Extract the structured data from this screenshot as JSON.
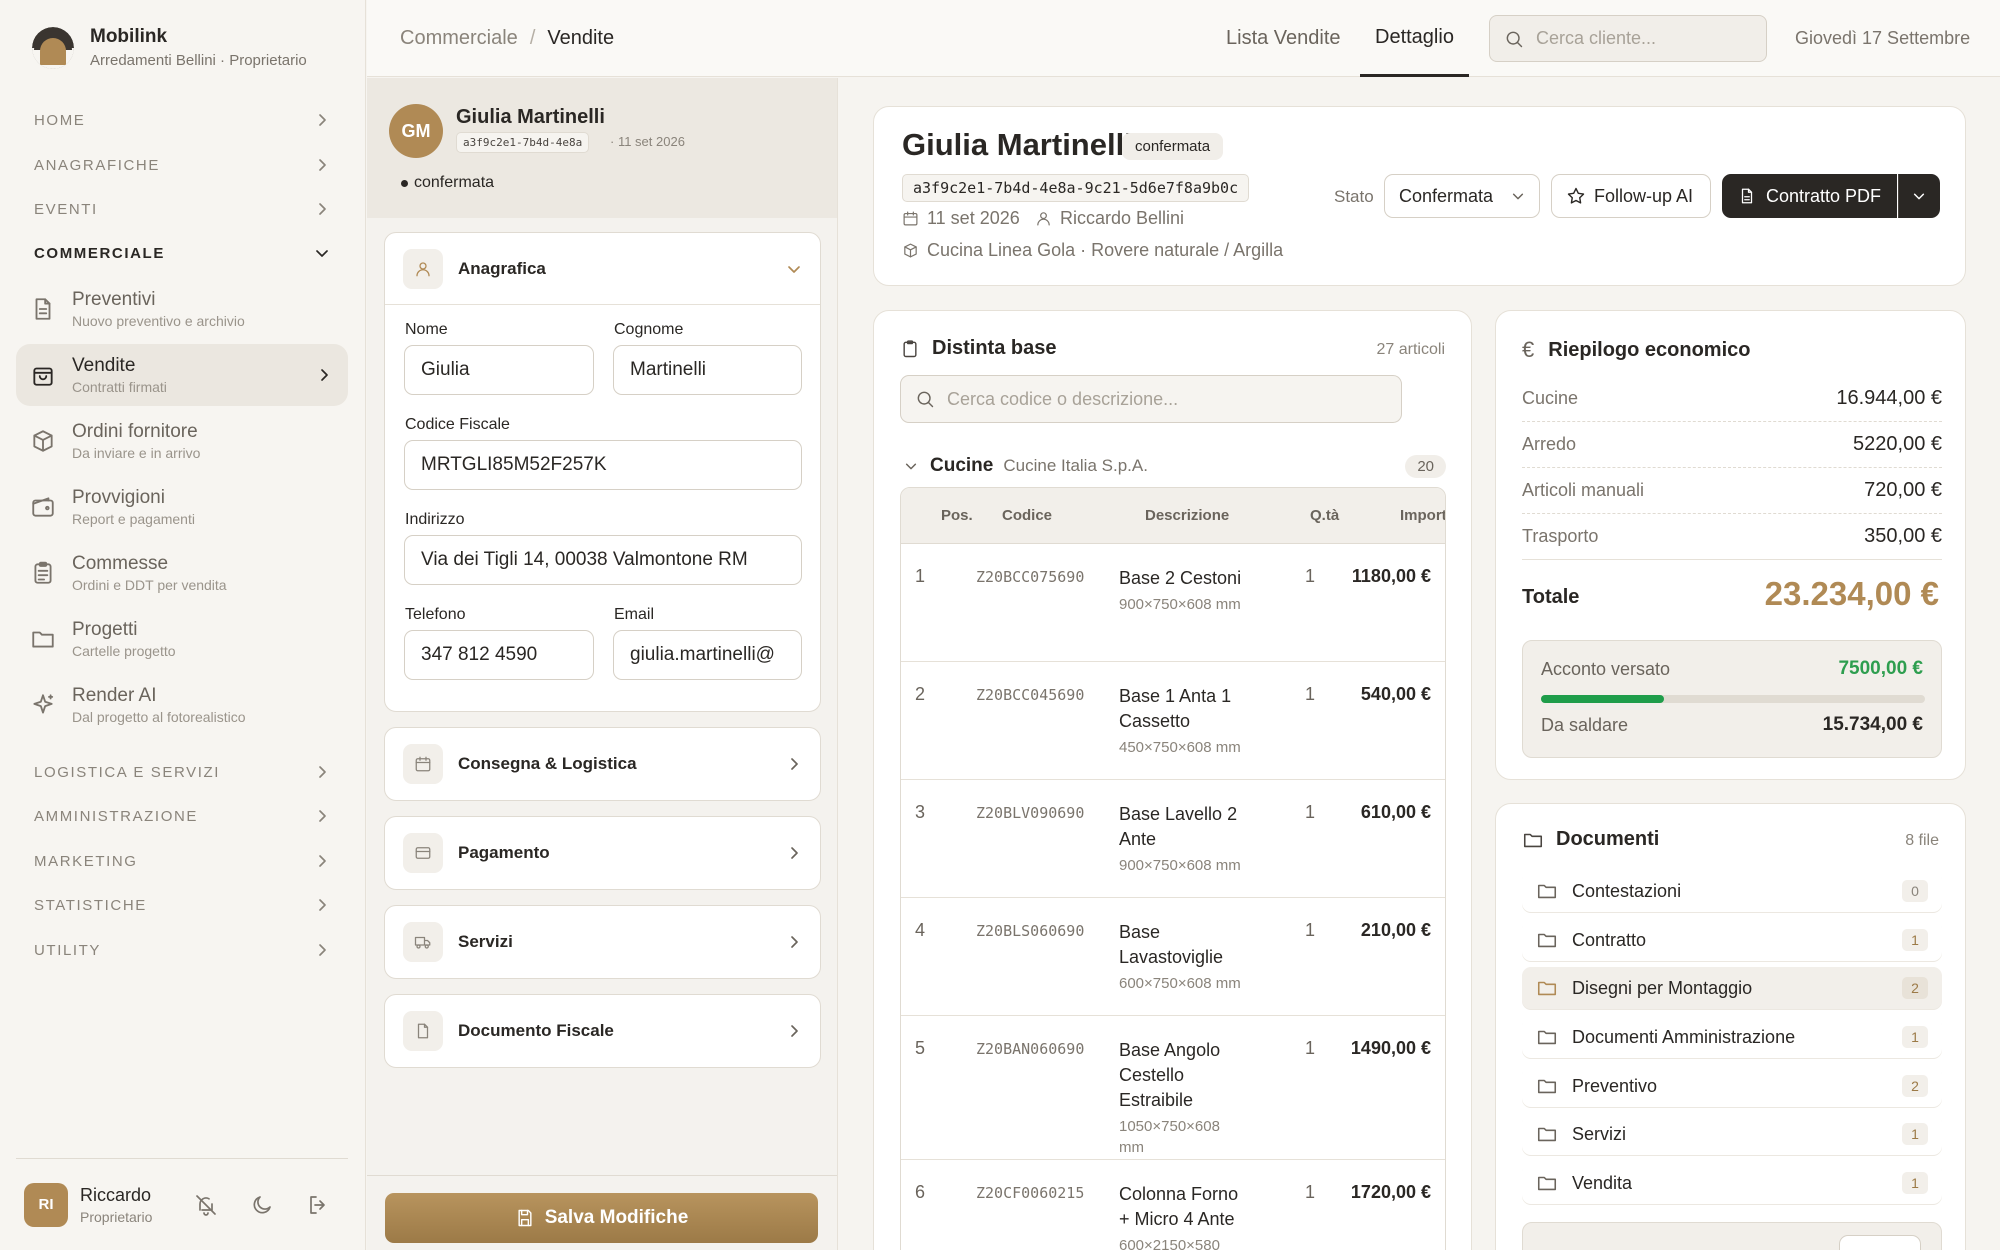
{
  "app": {
    "name": "Mobilink",
    "subtitle": "Arredamenti Bellini · Proprietario"
  },
  "sidebar": {
    "sections_top": [
      {
        "label": "HOME"
      },
      {
        "label": "ANAGRAFICHE"
      },
      {
        "label": "EVENTI"
      },
      {
        "label": "COMMERCIALE"
      }
    ],
    "items": [
      {
        "label": "Preventivi",
        "sub": "Nuovo preventivo e archivio",
        "icon": "document-icon"
      },
      {
        "label": "Vendite",
        "sub": "Contratti firmati",
        "icon": "bag-icon"
      },
      {
        "label": "Ordini fornitore",
        "sub": "Da inviare e in arrivo",
        "icon": "box-icon"
      },
      {
        "label": "Provvigioni",
        "sub": "Report e pagamenti",
        "icon": "wallet-icon"
      },
      {
        "label": "Commesse",
        "sub": "Ordini e DDT per vendita",
        "icon": "clipboard-icon"
      },
      {
        "label": "Progetti",
        "sub": "Cartelle progetto",
        "icon": "folder-icon"
      },
      {
        "label": "Render AI",
        "sub": "Dal progetto al fotorealistico",
        "icon": "sparkle-icon"
      }
    ],
    "sections_bottom": [
      {
        "label": "LOGISTICA E SERVIZI"
      },
      {
        "label": "AMMINISTRAZIONE"
      },
      {
        "label": "MARKETING"
      },
      {
        "label": "STATISTICHE"
      },
      {
        "label": "UTILITY"
      }
    ],
    "user": {
      "initials": "RI",
      "name": "Riccardo",
      "role": "Proprietario"
    }
  },
  "topbar": {
    "breadcrumb": [
      "Commerciale",
      "/",
      "Vendite"
    ],
    "tabs": [
      "Lista Vendite",
      "Dettaglio"
    ],
    "search_placeholder": "Cerca cliente...",
    "date": "Giovedì 17 Settembre"
  },
  "form": {
    "initials": "GM",
    "name": "Giulia Martinelli",
    "code": "a3f9c2e1-7b4d-4e8a",
    "date": "· 11 set 2026",
    "status": "confermata",
    "anagrafica": {
      "title": "Anagrafica",
      "nome_label": "Nome",
      "nome": "Giulia",
      "cognome_label": "Cognome",
      "cognome": "Martinelli",
      "cf_label": "Codice Fiscale",
      "cf": "MRTGLI85M52F257K",
      "indirizzo_label": "Indirizzo",
      "indirizzo": "Via dei Tigli 14, 00038 Valmontone RM",
      "telefono_label": "Telefono",
      "telefono": "347 812 4590",
      "email_label": "Email",
      "email": "giulia.martinelli@"
    },
    "sections": [
      "Consegna & Logistica",
      "Pagamento",
      "Servizi",
      "Documento Fiscale"
    ],
    "save_label": "Salva Modifiche"
  },
  "detail": {
    "name": "Giulia Martinelli",
    "badge": "confermata",
    "code": "a3f9c2e1-7b4d-4e8a-9c21-5d6e7f8a9b0c",
    "date": "11 set 2026",
    "agent": "Riccardo Bellini",
    "product": "Cucina Linea Gola · Rovere naturale / Argilla",
    "stato_label": "Stato",
    "stato_value": "Confermata",
    "followup_label": "Follow-up AI",
    "pdf_label": "Contratto PDF"
  },
  "distinta": {
    "title": "Distinta base",
    "count": "27 articoli",
    "search_placeholder": "Cerca codice o descrizione...",
    "group": {
      "name": "Cucine",
      "supplier": "Cucine Italia S.p.A.",
      "count": "20"
    },
    "columns": [
      "Pos.",
      "Codice",
      "Descrizione",
      "Q.tà",
      "Importo"
    ],
    "rows": [
      {
        "pos": "1",
        "code": "Z20BCC075690",
        "desc": "Base 2 Cestoni",
        "dim": "900×750×608 mm",
        "qty": "1",
        "imp": "1180,00 €"
      },
      {
        "pos": "2",
        "code": "Z20BCC045690",
        "desc": "Base 1 Anta 1 Cassetto",
        "dim": "450×750×608 mm",
        "qty": "1",
        "imp": "540,00 €"
      },
      {
        "pos": "3",
        "code": "Z20BLV090690",
        "desc": "Base Lavello 2 Ante",
        "dim": "900×750×608 mm",
        "qty": "1",
        "imp": "610,00 €"
      },
      {
        "pos": "4",
        "code": "Z20BLS060690",
        "desc": "Base Lavastoviglie",
        "dim": "600×750×608 mm",
        "qty": "1",
        "imp": "210,00 €"
      },
      {
        "pos": "5",
        "code": "Z20BAN060690",
        "desc": "Base Angolo Cestello Estraibile",
        "dim": "1050×750×608 mm",
        "qty": "1",
        "imp": "1490,00 €"
      },
      {
        "pos": "6",
        "code": "Z20CF0060215",
        "desc": "Colonna Forno + Micro 4 Ante",
        "dim": "600×2150×580",
        "qty": "1",
        "imp": "1720,00 €"
      }
    ]
  },
  "riepilogo": {
    "title": "Riepilogo economico",
    "lines": [
      {
        "label": "Cucine",
        "value": "16.944,00 €"
      },
      {
        "label": "Arredo",
        "value": "5220,00 €"
      },
      {
        "label": "Articoli manuali",
        "value": "720,00 €"
      },
      {
        "label": "Trasporto",
        "value": "350,00 €"
      }
    ],
    "totale_label": "Totale",
    "totale": "23.234,00 €",
    "acconto_label": "Acconto versato",
    "acconto": "7500,00 €",
    "acconto_fraction": 0.32,
    "saldo_label": "Da saldare",
    "saldo": "15.734,00 €"
  },
  "documenti": {
    "title": "Documenti",
    "count": "8 file",
    "folders": [
      {
        "name": "Contestazioni",
        "count": "0"
      },
      {
        "name": "Contratto",
        "count": "1"
      },
      {
        "name": "Disegni per Montaggio",
        "count": "2"
      },
      {
        "name": "Documenti Amministrazione",
        "count": "1"
      },
      {
        "name": "Preventivo",
        "count": "2"
      },
      {
        "name": "Servizi",
        "count": "1"
      },
      {
        "name": "Vendita",
        "count": "1"
      }
    ]
  },
  "colors": {
    "accent": "#b08a55",
    "dark": "#2a2724",
    "green": "#2e9e4f",
    "progress": "#1f9d4a"
  }
}
